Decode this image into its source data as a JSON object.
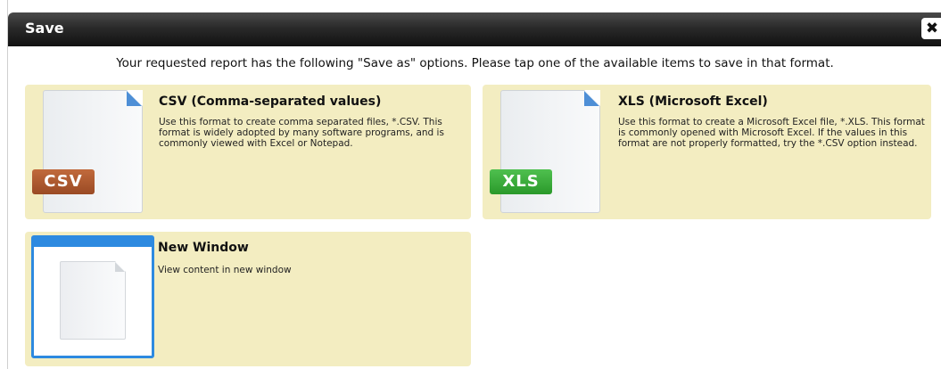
{
  "dialog": {
    "title": "Save",
    "close_label": "✖",
    "intro": "Your requested report has the following \"Save as\" options. Please tap one of the available items to save in that format."
  },
  "options": [
    {
      "title": "CSV (Comma-separated values)",
      "description": "Use this format to create comma separated files, *.CSV. This format is widely adopted by many software programs, and is commonly viewed with Excel or Notepad.",
      "badge": "CSV",
      "badge_color": "#a9522b"
    },
    {
      "title": "XLS (Microsoft Excel)",
      "description": "Use this format to create a Microsoft Excel file, *.XLS. This format is commonly opened with Microsoft Excel. If the values in this format are not properly formatted, try the *.CSV option instead.",
      "badge": "XLS",
      "badge_color": "#36a836"
    },
    {
      "title": "New Window",
      "description": "View content in new window",
      "icon": "new-window-icon"
    }
  ],
  "colors": {
    "option_background": "#f3edc1",
    "titlebar": "#222222",
    "window_accent": "#2d8ae0"
  }
}
